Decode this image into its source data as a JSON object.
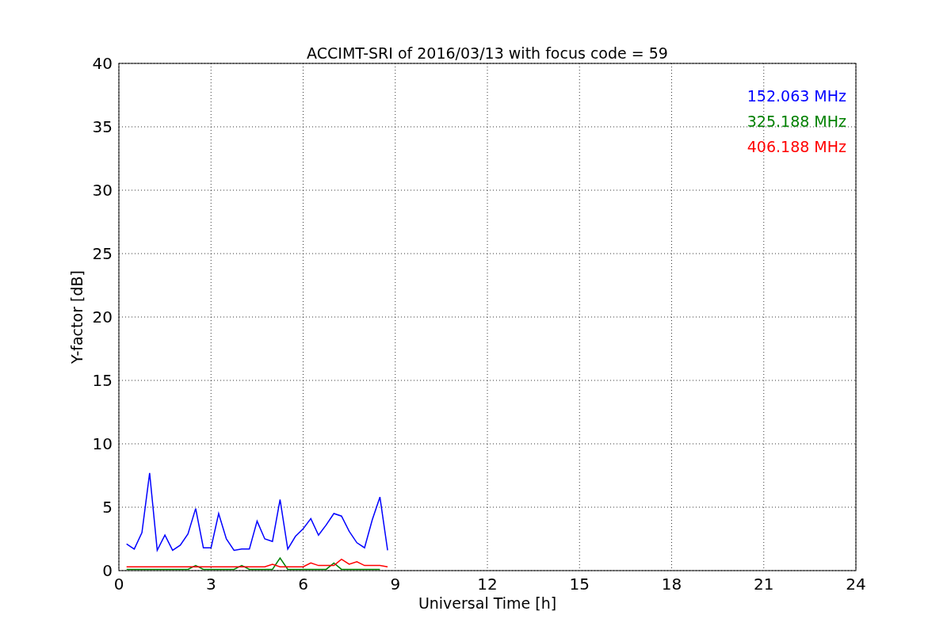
{
  "chart_data": {
    "type": "line",
    "title": "ACCIMT-SRI of 2016/03/13 with focus code = 59",
    "xlabel": "Universal Time [h]",
    "ylabel": "Y-factor [dB]",
    "x": [
      0.25,
      0.5,
      0.75,
      1.0,
      1.25,
      1.5,
      1.75,
      2.0,
      2.25,
      2.5,
      2.75,
      3.0,
      3.25,
      3.5,
      3.75,
      4.0,
      4.25,
      4.5,
      4.75,
      5.0,
      5.25,
      5.5,
      5.75,
      6.0,
      6.25,
      6.5,
      6.75,
      7.0,
      7.25,
      7.5,
      7.75,
      8.0,
      8.25,
      8.5,
      8.75
    ],
    "series": [
      {
        "name": "152.063 MHz",
        "color": "#0000ff",
        "values": [
          2.1,
          1.7,
          3.0,
          7.7,
          1.6,
          2.8,
          1.6,
          2.0,
          2.9,
          4.9,
          1.8,
          1.8,
          4.5,
          2.5,
          1.6,
          1.7,
          1.7,
          3.9,
          2.5,
          2.3,
          5.6,
          1.7,
          2.7,
          3.3,
          4.1,
          2.8,
          3.6,
          4.5,
          4.3,
          3.1,
          2.2,
          1.8,
          4.0,
          5.8,
          1.6
        ]
      },
      {
        "name": "325.188 MHz",
        "color": "#008000",
        "values": [
          0.1,
          0.1,
          0.1,
          0.1,
          0.1,
          0.1,
          0.1,
          0.1,
          0.1,
          0.4,
          0.1,
          0.1,
          0.1,
          0.1,
          0.1,
          0.4,
          0.1,
          0.1,
          0.1,
          0.1,
          1.0,
          0.1,
          0.1,
          0.1,
          0.1,
          0.1,
          0.1,
          0.6,
          0.1,
          0.1,
          0.1,
          0.1,
          0.1,
          0.1,
          null
        ]
      },
      {
        "name": "406.188 MHz",
        "color": "#ff0000",
        "values": [
          0.3,
          0.3,
          0.3,
          0.3,
          0.3,
          0.3,
          0.3,
          0.3,
          0.3,
          0.3,
          0.3,
          0.3,
          0.3,
          0.3,
          0.3,
          0.3,
          0.3,
          0.3,
          0.3,
          0.5,
          0.3,
          0.3,
          0.3,
          0.3,
          0.6,
          0.4,
          0.4,
          0.4,
          0.9,
          0.5,
          0.7,
          0.4,
          0.4,
          0.4,
          0.3
        ]
      }
    ],
    "grid": true,
    "xlim": [
      0,
      24
    ],
    "ylim": [
      0,
      40
    ],
    "xticks": [
      0,
      3,
      6,
      9,
      12,
      15,
      18,
      21,
      24
    ],
    "yticks": [
      0,
      5,
      10,
      15,
      20,
      25,
      30,
      35,
      40
    ]
  }
}
